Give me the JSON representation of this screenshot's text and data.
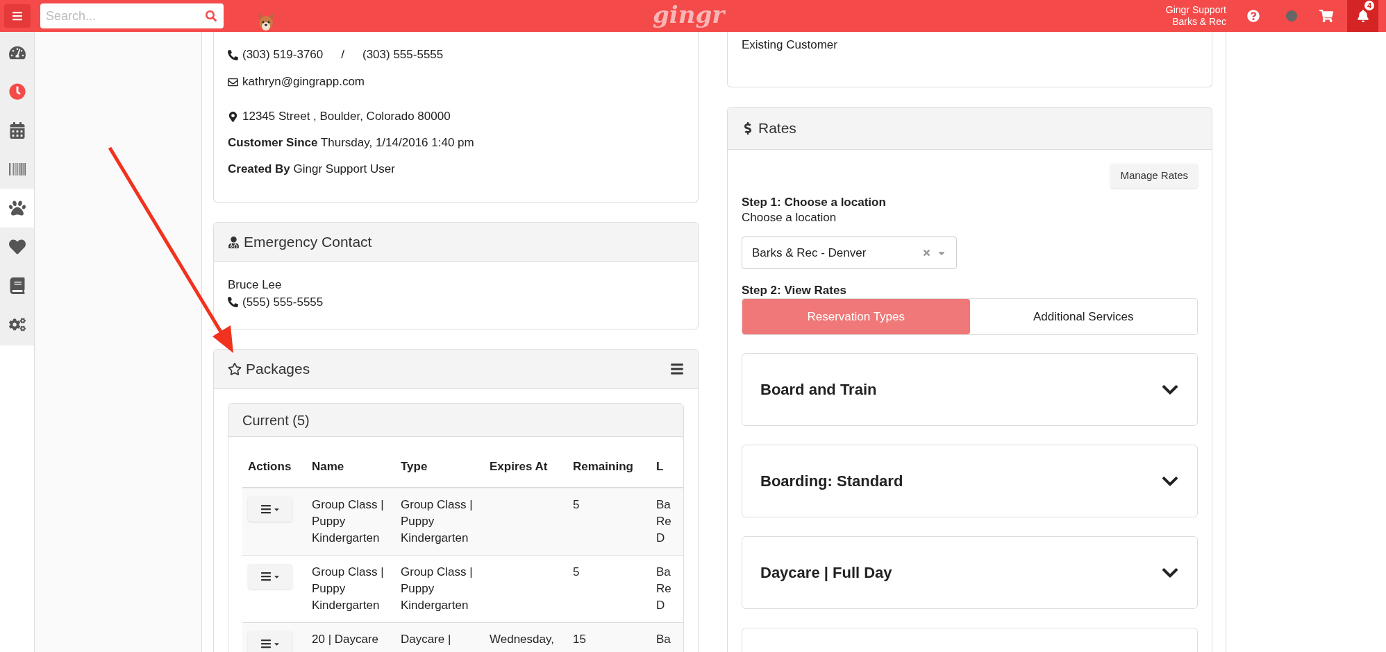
{
  "topbar": {
    "search_placeholder": "Search...",
    "logo": "gingr",
    "user_name": "Gingr Support",
    "user_location": "Barks & Rec",
    "notification_count": "4"
  },
  "sidebar": {
    "items": [
      {
        "kind": "dashboard",
        "selected": false
      },
      {
        "kind": "clock",
        "selected": false
      },
      {
        "kind": "calendar",
        "selected": false
      },
      {
        "kind": "barcode",
        "selected": false
      },
      {
        "kind": "paw",
        "selected": true
      },
      {
        "kind": "heart",
        "selected": false
      },
      {
        "kind": "book",
        "selected": false
      },
      {
        "kind": "settings",
        "selected": false
      }
    ]
  },
  "contact_card": {
    "phones": [
      "(303) 519-3760",
      "(303) 555-5555"
    ],
    "phone_separator": "/",
    "email": "kathryn@gingrapp.com",
    "address": "12345 Street , Boulder, Colorado 80000",
    "details": [
      {
        "label": "Customer Since",
        "value": "Thursday, 1/14/2016 1:40 pm"
      },
      {
        "label": "Created By",
        "value": "Gingr Support User"
      }
    ]
  },
  "emergency_contact": {
    "title": "Emergency Contact",
    "name": "Bruce Lee",
    "phone": "(555) 555-5555"
  },
  "packages": {
    "title": "Packages",
    "current": {
      "title": "Current (5)",
      "columns": [
        "Actions",
        "Name",
        "Type",
        "Expires At",
        "Remaining",
        "L"
      ],
      "rows": [
        {
          "name": "Group Class | Puppy Kindergarten",
          "type": "Group Class | Puppy Kindergarten",
          "expires_at": "",
          "remaining": "5",
          "location": "Ba Re D"
        },
        {
          "name": "Group Class | Puppy Kindergarten",
          "type": "Group Class | Puppy Kindergarten",
          "expires_at": "",
          "remaining": "5",
          "location": "Ba Re D"
        },
        {
          "name": "20 | Daycare",
          "type": "Daycare |",
          "expires_at": "Wednesday,",
          "remaining": "15",
          "location": "Ba"
        }
      ]
    }
  },
  "status_card": {
    "text": "Existing Customer"
  },
  "rates": {
    "title": "Rates",
    "manage_button": "Manage Rates",
    "step1_title": "Step 1: Choose a location",
    "step1_label": "Choose a location",
    "location_value": "Barks & Rec - Denver",
    "step2_title": "Step 2: View Rates",
    "tabs": [
      {
        "label": "Reservation Types",
        "selected": true
      },
      {
        "label": "Additional Services",
        "selected": false
      }
    ],
    "sections": [
      {
        "title": "Board and Train",
        "expanded": false
      },
      {
        "title": "Boarding: Standard",
        "expanded": false
      },
      {
        "title": "Daycare | Full Day",
        "expanded": false
      }
    ],
    "more_sections_below": true
  }
}
